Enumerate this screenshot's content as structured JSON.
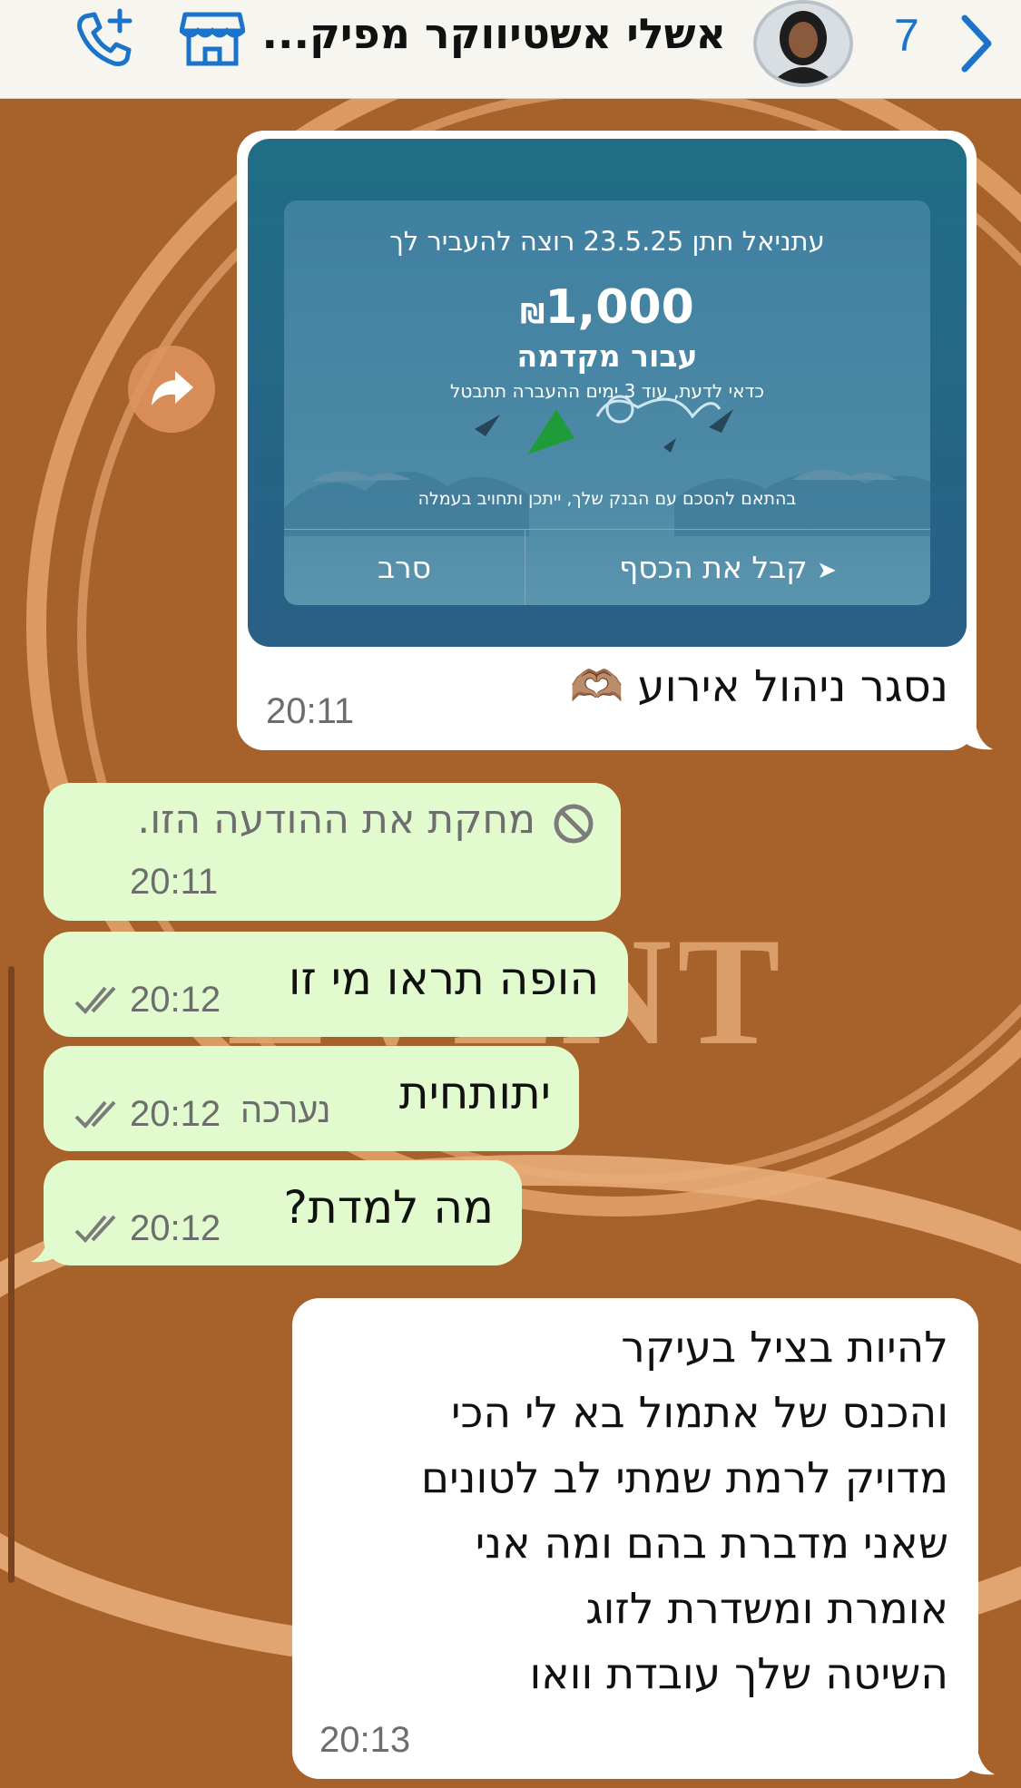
{
  "header": {
    "back_count": "7",
    "contact_name": "אשלי אשטיווקר מפיק...",
    "avatar_icon": "contact-avatar-photo",
    "store_icon": "store-icon",
    "call_icon": "add-call-icon"
  },
  "background": {
    "watermark_text": "EVENT",
    "colors": {
      "base": "#a7622c",
      "ring": "#e8b07a"
    }
  },
  "messages": [
    {
      "id": "m1",
      "direction": "outgoing",
      "card": {
        "title": "עתניאל חתן 23.5.25 רוצה להעביר לך",
        "amount": "1,000",
        "currency": "₪",
        "purpose": "עבור מקדמה",
        "notice": "כדאי לדעת, עוד 3 ימים ההעברה תתבטל",
        "footnote": "בהתאם להסכם עם הבנק שלך, ייתכן ותחויב בעמלה",
        "accept_label": "קבל את הכסף",
        "decline_label": "סרב"
      },
      "text": "נסגר ניהול אירוע 🫶🏽",
      "time": "20:11"
    },
    {
      "id": "m2",
      "direction": "incoming",
      "deleted": true,
      "text": "מחקת את ההודעה הזו.",
      "time": "20:11"
    },
    {
      "id": "m3",
      "direction": "incoming",
      "text": "הופה תראו מי זו",
      "time": "20:12",
      "status": "read"
    },
    {
      "id": "m4",
      "direction": "incoming",
      "text": "יתותחית",
      "time": "20:12",
      "edited_label": "נערכה",
      "status": "read"
    },
    {
      "id": "m5",
      "direction": "incoming",
      "text": "מה למדת?",
      "time": "20:12",
      "status": "read"
    },
    {
      "id": "m6",
      "direction": "outgoing",
      "lines": [
        "להיות בציל בעיקר",
        "והכנס של אתמול בא לי הכי",
        "מדויק לרמת שמתי לב לטונים",
        "שאני מדברת בהם ומה אני",
        "אומרת ומשדרת לזוג",
        "השיטה שלך עובדת וואו"
      ],
      "time": "20:13"
    }
  ]
}
